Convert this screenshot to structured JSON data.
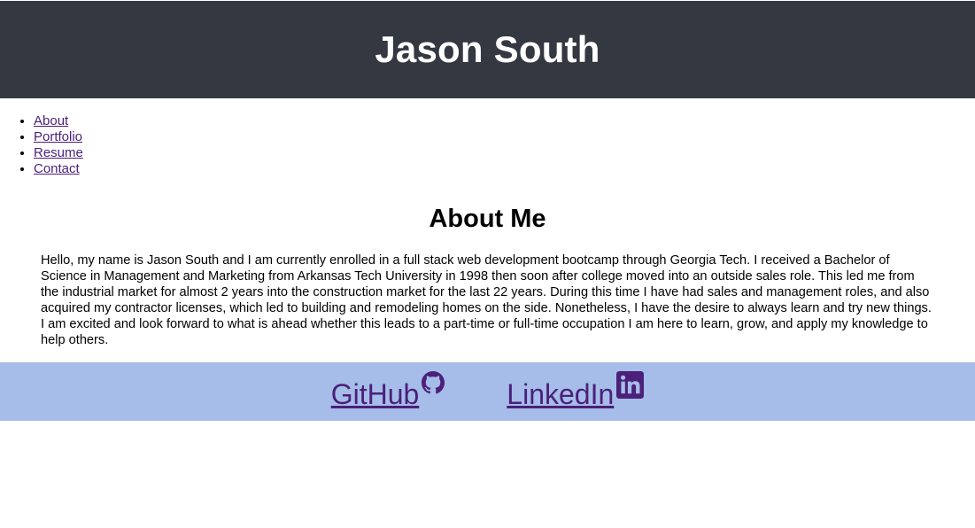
{
  "header": {
    "title": "Jason South"
  },
  "nav": {
    "items": [
      {
        "label": "About"
      },
      {
        "label": "Portfolio"
      },
      {
        "label": "Resume"
      },
      {
        "label": "Contact"
      }
    ]
  },
  "about": {
    "heading": "About Me",
    "body": "Hello, my name is Jason South and I am currently enrolled in a full stack web development bootcamp through Georgia Tech. I received a Bachelor of Science in Management and Marketing from Arkansas Tech University in 1998 then soon after college moved into an outside sales role. This led me from the industrial market for almost 2 years into the construction market for the last 22 years. During this time I have had sales and management roles, and also acquired my contractor licenses, which led to building and remodeling homes on the side. Nonetheless, I have the desire to always learn and try new things. I am excited and look forward to what is ahead whether this leads to a part-time or full-time occupation I am here to learn, grow, and apply my knowledge to help others."
  },
  "footer": {
    "links": [
      {
        "label": "GitHub",
        "icon": "github-icon"
      },
      {
        "label": "LinkedIn",
        "icon": "linkedin-icon"
      }
    ]
  },
  "colors": {
    "header_bg": "#343841",
    "footer_bg": "#a5bde8",
    "link": "#4b1f7a"
  }
}
